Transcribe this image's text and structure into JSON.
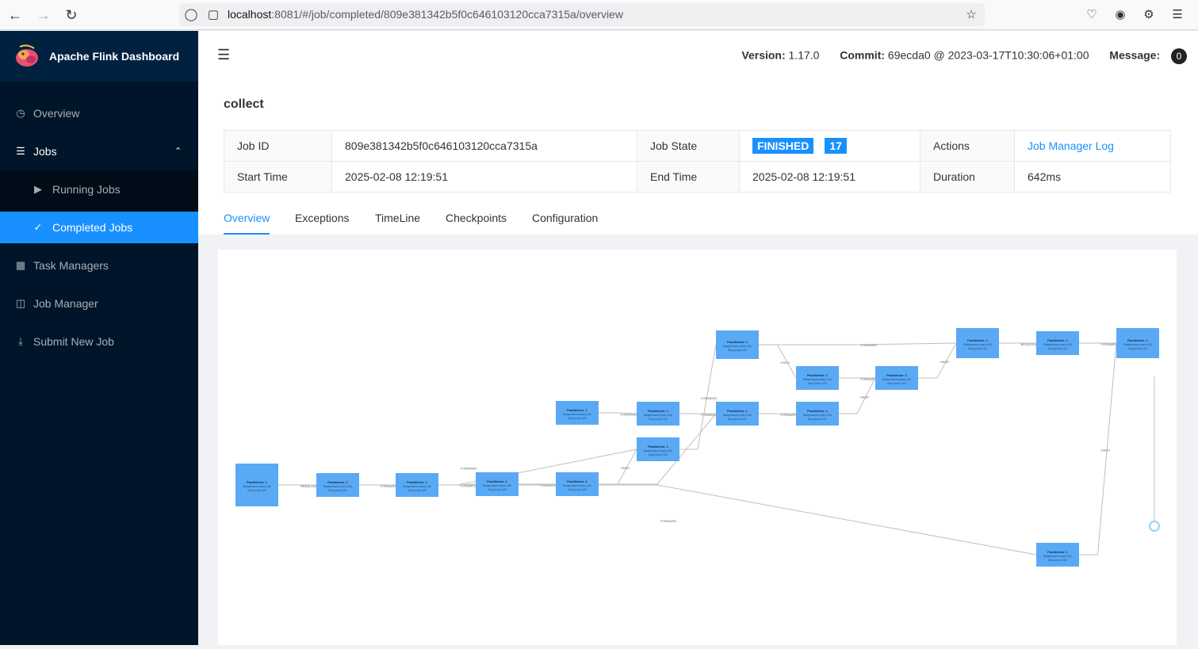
{
  "browser": {
    "url_host": "localhost",
    "url_rest": ":8081/#/job/completed/809e381342b5f0c646103120cca7315a/overview"
  },
  "sidebar": {
    "brand": "Apache Flink Dashboard",
    "items": [
      {
        "label": "Overview",
        "icon": "dashboard-icon"
      },
      {
        "label": "Jobs",
        "icon": "list-icon"
      },
      {
        "label": "Running Jobs",
        "icon": "play-circle-icon"
      },
      {
        "label": "Completed Jobs",
        "icon": "check-circle-icon"
      },
      {
        "label": "Task Managers",
        "icon": "schedule-icon"
      },
      {
        "label": "Job Manager",
        "icon": "build-icon"
      },
      {
        "label": "Submit New Job",
        "icon": "upload-icon"
      }
    ]
  },
  "header": {
    "version_label": "Version:",
    "version": "1.17.0",
    "commit_label": "Commit:",
    "commit": "69ecda0 @ 2023-03-17T10:30:06+01:00",
    "message_label": "Message:",
    "message_count": "0"
  },
  "job": {
    "title": "collect",
    "id_label": "Job ID",
    "id": "809e381342b5f0c646103120cca7315a",
    "state_label": "Job State",
    "state": "FINISHED",
    "task_count": "17",
    "actions_label": "Actions",
    "actions_link": "Job Manager Log",
    "start_label": "Start Time",
    "start": "2025-02-08 12:19:51",
    "end_label": "End Time",
    "end": "2025-02-08 12:19:51",
    "duration_label": "Duration",
    "duration": "642ms"
  },
  "tabs": [
    "Overview",
    "Exceptions",
    "TimeLine",
    "Checkpoints",
    "Configuration"
  ],
  "graph": {
    "colors": {
      "node": "#5aa9f5",
      "edge": "#bfbfbf"
    },
    "parallelism_text": "Parallelism: 1",
    "metric_text": "Backpressure (max): N/A",
    "busy_text": "Busy (max): N/A",
    "edge_labels": [
      "REBALANCE",
      "FORWARD",
      "HASH",
      "BROADCAST"
    ]
  }
}
